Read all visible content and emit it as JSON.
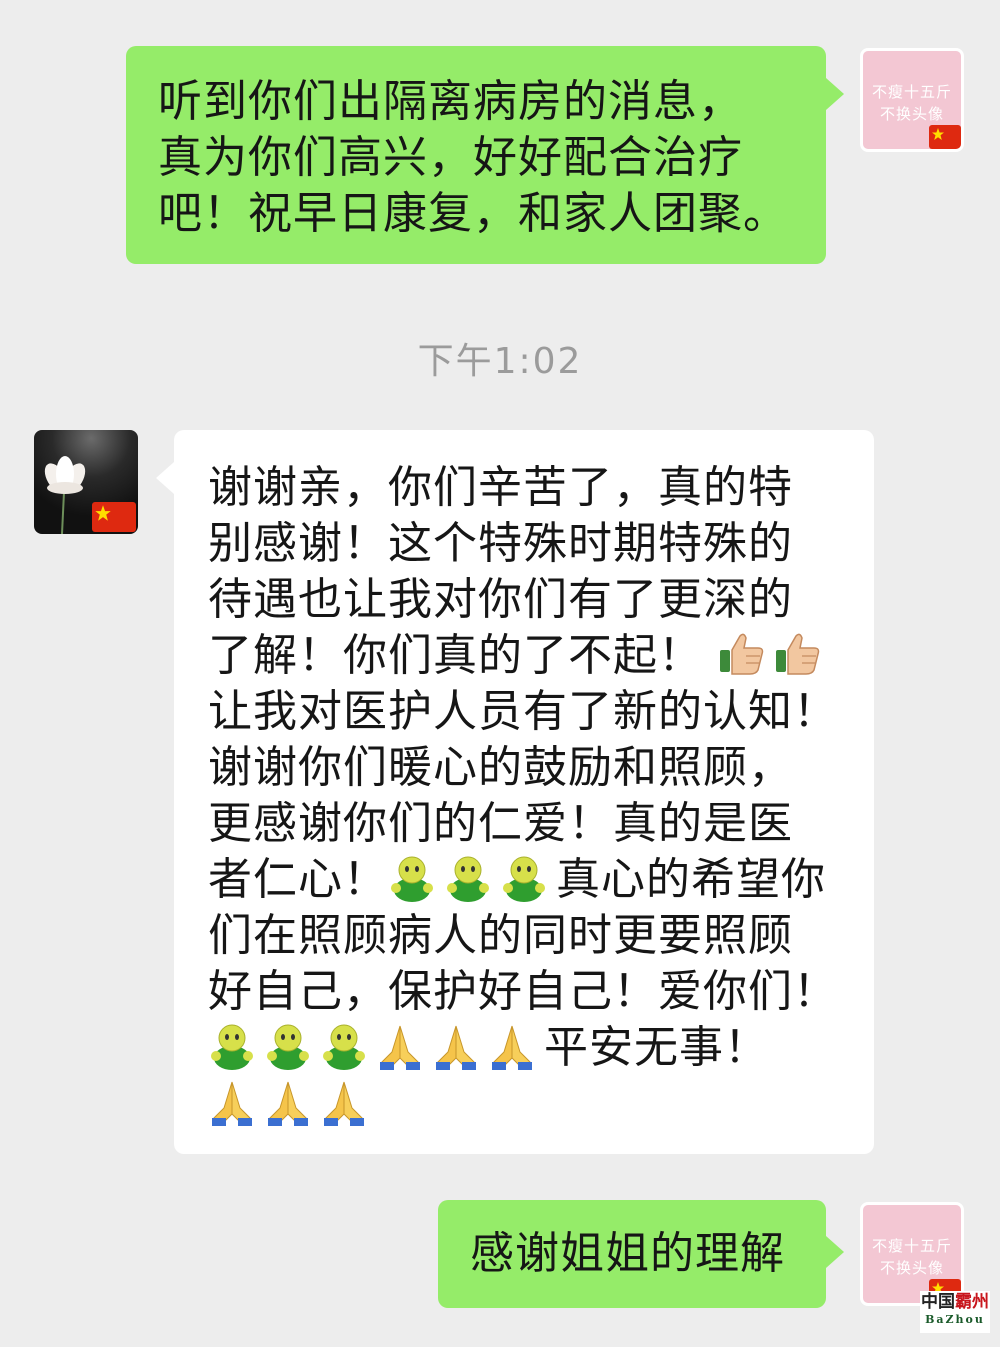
{
  "messages": [
    {
      "side": "me",
      "lines": [
        "听到你们出隔离病房的消息，",
        "真为你们高兴，好好配合治疗",
        "吧！祝早日康复，和家人团聚。"
      ]
    },
    {
      "side": "timestamp",
      "text": "下午1:02"
    },
    {
      "side": "them",
      "lines": [
        "谢谢亲，你们辛苦了，真的特",
        "别感谢！这个特殊时期特殊的",
        "待遇也让我对你们有了更深的",
        "了解！你们真的了不起！",
        "让我对医护人员有了新的认知！",
        "谢谢你们暖心的鼓励和照顾，",
        "更感谢你们的仁爱！真的是医",
        "者仁心！",
        "真心的希望你",
        "们在照顾病人的同时更要照顾",
        "好自己，保护好自己！爱你们！",
        "平安无事！"
      ]
    },
    {
      "side": "me",
      "lines": [
        "感谢姐姐的理解"
      ]
    }
  ],
  "avatars": {
    "me_text_line1": "不瘦十五斤",
    "me_text_line2": "不换头像"
  },
  "emoji_names": [
    "thumbs-up-icon",
    "green-person-icon",
    "folded-hands-icon"
  ],
  "watermark": {
    "prefix": "中国",
    "highlight": "霸州",
    "sub": "BaZhou"
  },
  "colors": {
    "my_bubble": "#95ec69",
    "their_bubble": "#ffffff",
    "background": "#ededed",
    "timestamp": "#9b9b9b"
  }
}
